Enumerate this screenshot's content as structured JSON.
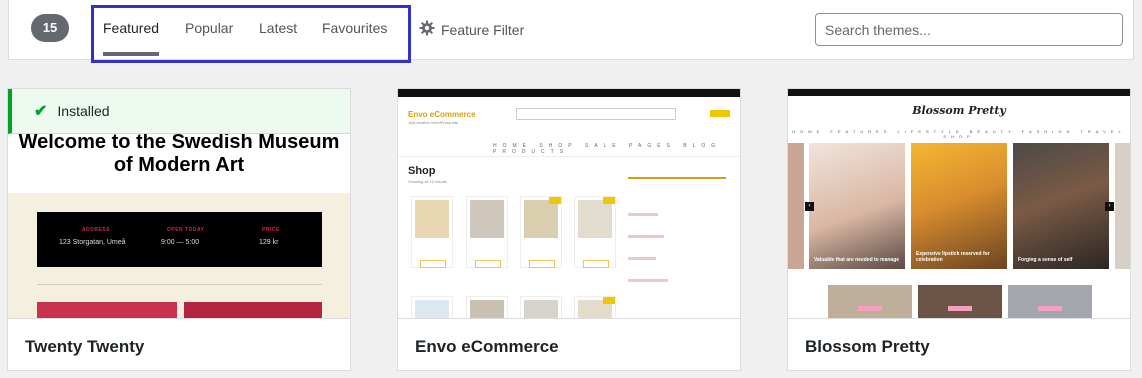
{
  "filter_bar": {
    "theme_count": "15",
    "tabs": [
      {
        "label": "Featured",
        "active": true
      },
      {
        "label": "Popular",
        "active": false
      },
      {
        "label": "Latest",
        "active": false
      },
      {
        "label": "Favourites",
        "active": false
      }
    ],
    "feature_filter_label": "Feature Filter",
    "search_placeholder": "Search themes..."
  },
  "themes": [
    {
      "name": "Twenty Twenty",
      "installed_label": "Installed",
      "preview": {
        "heading": "Welcome to the Swedish Museum of Modern Art",
        "info": [
          {
            "label": "ADDRESS",
            "value": "123 Storgatan, Umeå"
          },
          {
            "label": "OPEN TODAY",
            "value": "9:00 — 5:00"
          },
          {
            "label": "PRICE",
            "value": "129 kr"
          }
        ]
      }
    },
    {
      "name": "Envo eCommerce",
      "preview": {
        "brand": "Envo eCommerce",
        "tagline": "Just another WordPress site",
        "page_title": "Shop",
        "results": "Showing all 12 results",
        "nav": "HOME SHOP SALE PAGES BLOG PRODUCTS"
      }
    },
    {
      "name": "Blossom Pretty",
      "preview": {
        "logo": "Blossom Pretty",
        "nav": "HOME FEATURES LIFESTYLE BEAUTY FASHION TRAVEL SHOP",
        "slide_captions": [
          "Valuable that are needed to manage",
          "Expensive lipstick reserved for celebration",
          "Forging a sense of self"
        ]
      }
    }
  ],
  "colors": {
    "accent_box": "#3232c8",
    "installed_green": "#00a32a",
    "count_badge": "#646970"
  },
  "icons": {
    "feature_filter": "gear-icon",
    "installed": "check-icon"
  }
}
